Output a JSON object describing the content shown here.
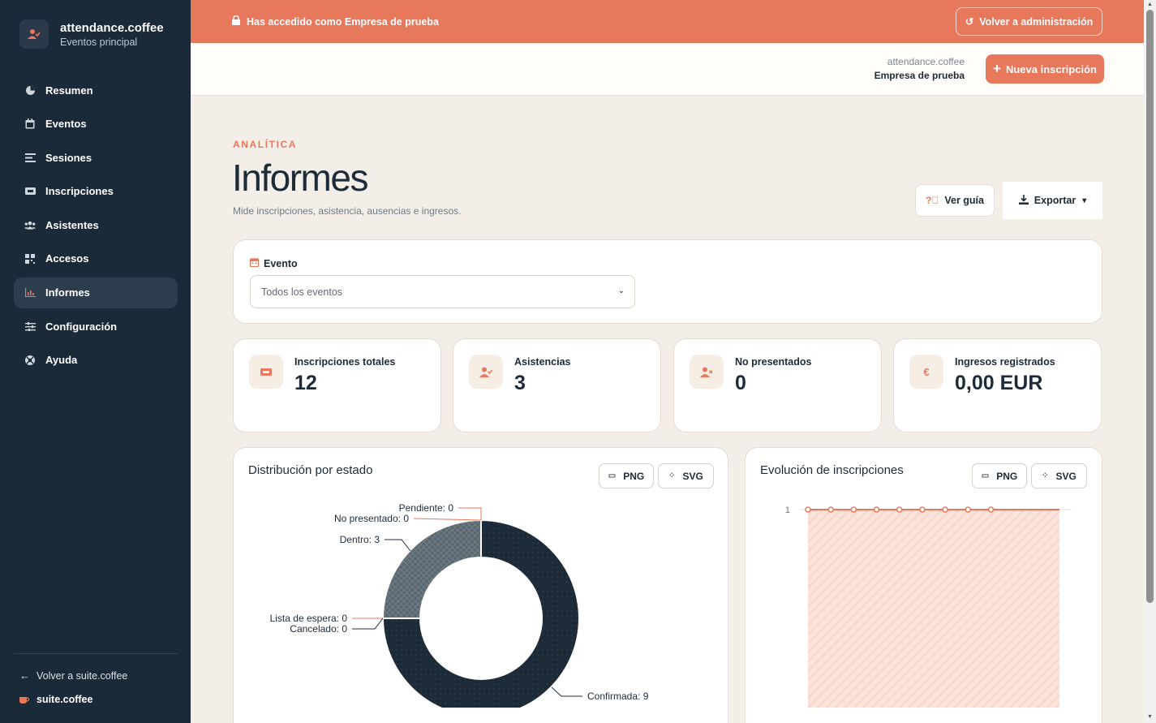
{
  "brand": {
    "name": "attendance.coffee",
    "subtitle": "Eventos principal"
  },
  "nav": [
    {
      "label": "Resumen",
      "icon": "pie-chart-icon",
      "glyph": "◕"
    },
    {
      "label": "Eventos",
      "icon": "calendar-icon",
      "glyph": "▦"
    },
    {
      "label": "Sesiones",
      "icon": "list-icon",
      "glyph": "☰"
    },
    {
      "label": "Inscripciones",
      "icon": "ticket-icon",
      "glyph": "▬"
    },
    {
      "label": "Asistentes",
      "icon": "users-icon",
      "glyph": "👥"
    },
    {
      "label": "Accesos",
      "icon": "qr-code-icon",
      "glyph": "▦"
    },
    {
      "label": "Informes",
      "icon": "chart-icon",
      "glyph": "📈",
      "active": true
    },
    {
      "label": "Configuración",
      "icon": "sliders-icon",
      "glyph": "≡"
    },
    {
      "label": "Ayuda",
      "icon": "help-icon",
      "glyph": "⊗"
    }
  ],
  "footer": {
    "back_label": "Volver a suite.coffee",
    "suite_label": "suite.coffee"
  },
  "banner": {
    "text": "Has accedido como Empresa de prueba",
    "button": "Volver a administración"
  },
  "header": {
    "app": "attendance.coffee",
    "org": "Empresa de prueba",
    "new_button": "Nueva inscripción"
  },
  "page": {
    "eyebrow": "ANALÍTICA",
    "title": "Informes",
    "subtitle": "Mide inscripciones, asistencia, ausencias e ingresos.",
    "guide_button": "Ver guía",
    "export_button": "Exportar"
  },
  "filter": {
    "label": "Evento",
    "selected": "Todos los eventos"
  },
  "stats": [
    {
      "label": "Inscripciones totales",
      "value": "12",
      "icon": "ticket-icon"
    },
    {
      "label": "Asistencias",
      "value": "3",
      "icon": "user-check-icon"
    },
    {
      "label": "No presentados",
      "value": "0",
      "icon": "user-x-icon"
    },
    {
      "label": "Ingresos registrados",
      "value": "0,00 EUR",
      "icon": "euro-icon"
    }
  ],
  "charts": {
    "png_label": "PNG",
    "svg_label": "SVG"
  },
  "chart_data": [
    {
      "type": "pie",
      "title": "Distribución por estado",
      "categories": [
        "Confirmada",
        "Dentro",
        "Pendiente",
        "No presentado",
        "Lista de espera",
        "Cancelado"
      ],
      "values": [
        9,
        3,
        0,
        0,
        0,
        0
      ],
      "colors": [
        "#1d2b38",
        "#5a6770",
        "#e8785c",
        "#e8785c",
        "#e8785c",
        "#1d2b38"
      ]
    },
    {
      "type": "area",
      "title": "Evolución de inscripciones",
      "yticks": [
        "1"
      ],
      "values": [
        1,
        1,
        1,
        1,
        1,
        1,
        1,
        1,
        1,
        1,
        1,
        1
      ],
      "color": "#e8785c"
    }
  ]
}
